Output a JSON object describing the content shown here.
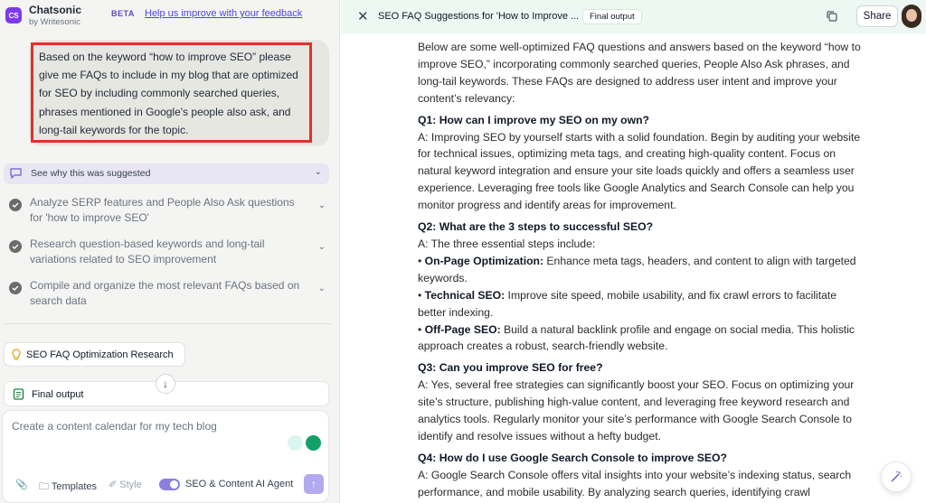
{
  "app": {
    "badge": "CS",
    "name": "Chatsonic",
    "by": "by Writesonic",
    "beta": "BETA",
    "feedback_link": "Help us improve with your feedback"
  },
  "prompt": {
    "text": "Based on the keyword “how to improve SEO” please give me FAQs to include in my blog that are optimized for SEO by including commonly searched queries, phrases mentioned in Google's people also ask, and long-tail keywords for the topic.",
    "highlight_color": "#e0312a"
  },
  "reasoning": {
    "why_label": "See why this was suggested",
    "steps": [
      {
        "text": "Analyze SERP features and People Also Ask questions for 'how to improve SEO'"
      },
      {
        "text": "Research question-based keywords and long-tail variations related to SEO improvement"
      },
      {
        "text": "Compile and organize the most relevant FAQs based on search data"
      }
    ]
  },
  "research_chip": "SEO FAQ Optimization Research",
  "final_chip": "Final output",
  "composer": {
    "placeholder": "Create a content calendar for my tech blog",
    "templates_label": "Templates",
    "style_label": "Style",
    "agent_label": "SEO & Content AI Agent",
    "agent_enabled": true
  },
  "document": {
    "title": "SEO FAQ Suggestions for 'How to Improve ...",
    "badge": "Final output",
    "share_label": "Share",
    "intro": "Below are some well-optimized FAQ questions and answers based on the keyword “how to improve SEO,” incorporating commonly searched queries, People Also Ask phrases, and long-tail keywords. These FAQs are designed to address user intent and improve your content’s relevancy:",
    "q1": "Q1: How can I improve my SEO on my own?",
    "a1": "A: Improving SEO by yourself starts with a solid foundation. Begin by auditing your website for technical issues, optimizing meta tags, and creating high-quality content. Focus on natural keyword integration and ensure your site loads quickly and offers a seamless user experience. Leveraging free tools like Google Analytics and Search Console can help you monitor progress and identify areas for improvement.",
    "q2": "Q2: What are the 3 steps to successful SEO?",
    "a2_lead": "A: The three essential steps include:",
    "a2_items": [
      {
        "bullet": "•",
        "term": "On-Page Optimization:",
        "text": " Enhance meta tags, headers, and content to align with targeted keywords."
      },
      {
        "bullet": "•",
        "term": "Technical SEO:",
        "text": " Improve site speed, mobile usability, and fix crawl errors to facilitate better indexing."
      },
      {
        "bullet": "•",
        "term": "Off-Page SEO:",
        "text": " Build a natural backlink profile and engage on social media. This holistic approach creates a robust, search-friendly website."
      }
    ],
    "q3": "Q3: Can you improve SEO for free?",
    "a3": "A: Yes, several free strategies can significantly boost your SEO. Focus on optimizing your site’s structure, publishing high-value content, and leveraging free keyword research and analytics tools. Regularly monitor your site’s performance with Google Search Console to identify and resolve issues without a hefty budget.",
    "q4": "Q4: How do I use Google Search Console to improve SEO?",
    "a4": "A: Google Search Console offers vital insights into your website’s indexing status, search performance, and mobile usability. By analyzing search queries, identifying crawl"
  },
  "colors": {
    "accent": "#7c3aed",
    "header_bg": "#eef8f3",
    "left_bg": "#f4f4f2"
  }
}
